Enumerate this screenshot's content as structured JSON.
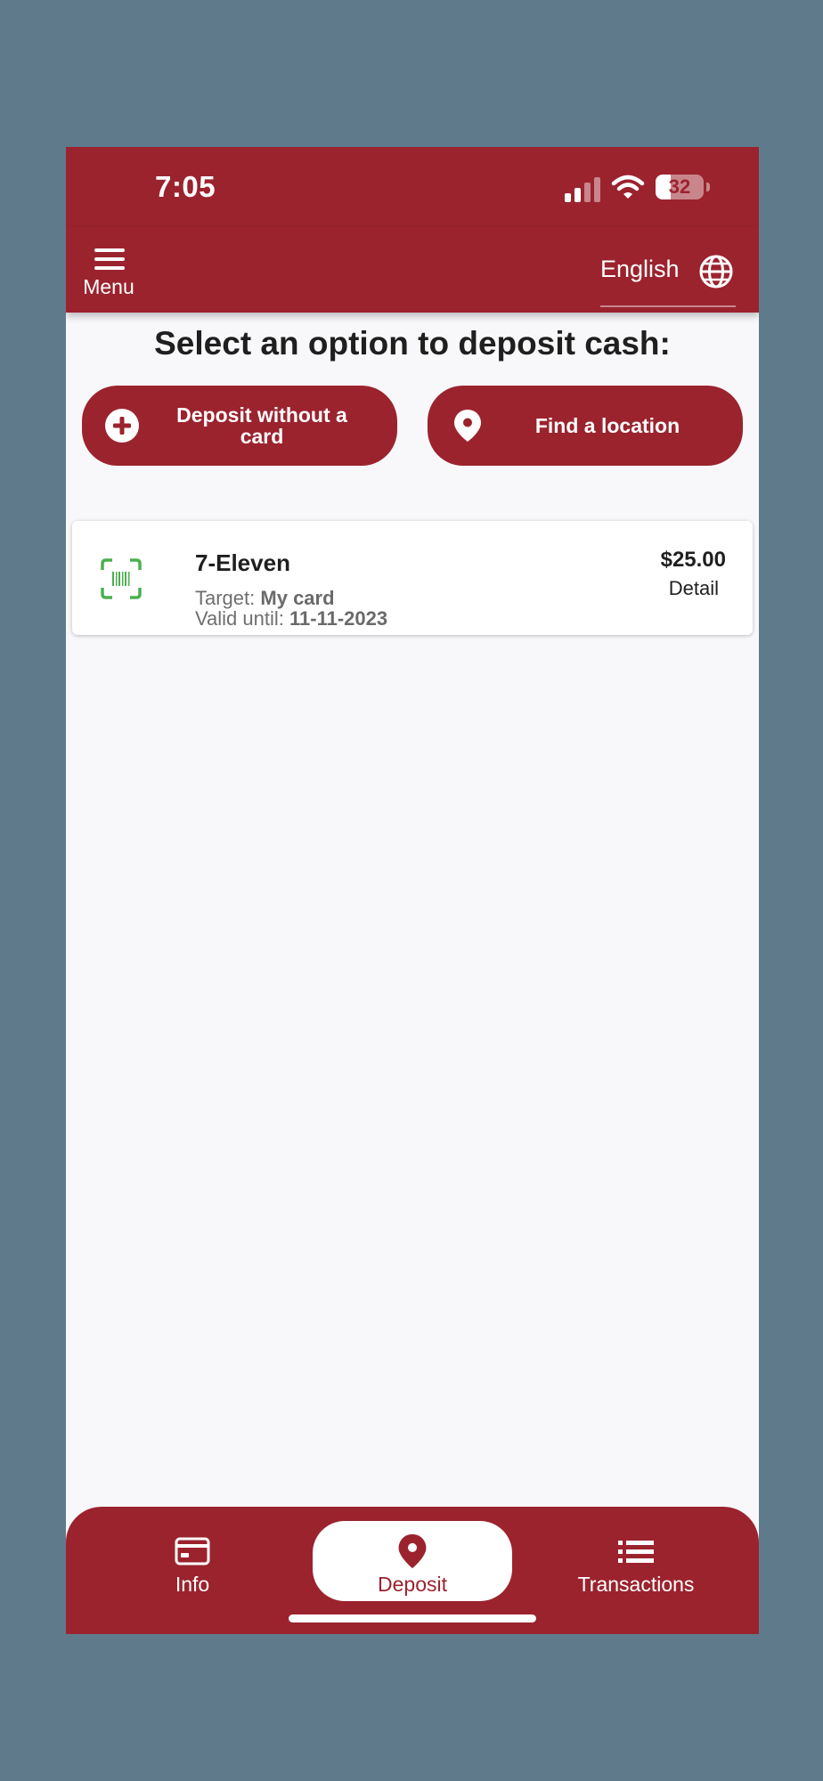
{
  "status_bar": {
    "time": "7:05",
    "battery": "32",
    "battery_level": 0.32
  },
  "header": {
    "menu_label": "Menu",
    "language": "English"
  },
  "title": "Select an option to deposit cash:",
  "actions": {
    "deposit_without_card": "Deposit without a card",
    "find_location": "Find a location"
  },
  "deposit_card": {
    "store": "7-Eleven",
    "target_label": "Target:",
    "target_value": "My card",
    "valid_label": "Valid until:",
    "valid_value": "11-11-2023",
    "amount": "$25.00",
    "detail": "Detail"
  },
  "nav": {
    "items": [
      {
        "label": "Info",
        "icon": "credit-card-icon"
      },
      {
        "label": "Deposit",
        "icon": "map-pin-icon",
        "active": true
      },
      {
        "label": "Transactions",
        "icon": "list-icon"
      }
    ]
  },
  "colors": {
    "brand": "#9b232e",
    "background": "#5f7b8b",
    "barcode_green": "#4caf50"
  }
}
